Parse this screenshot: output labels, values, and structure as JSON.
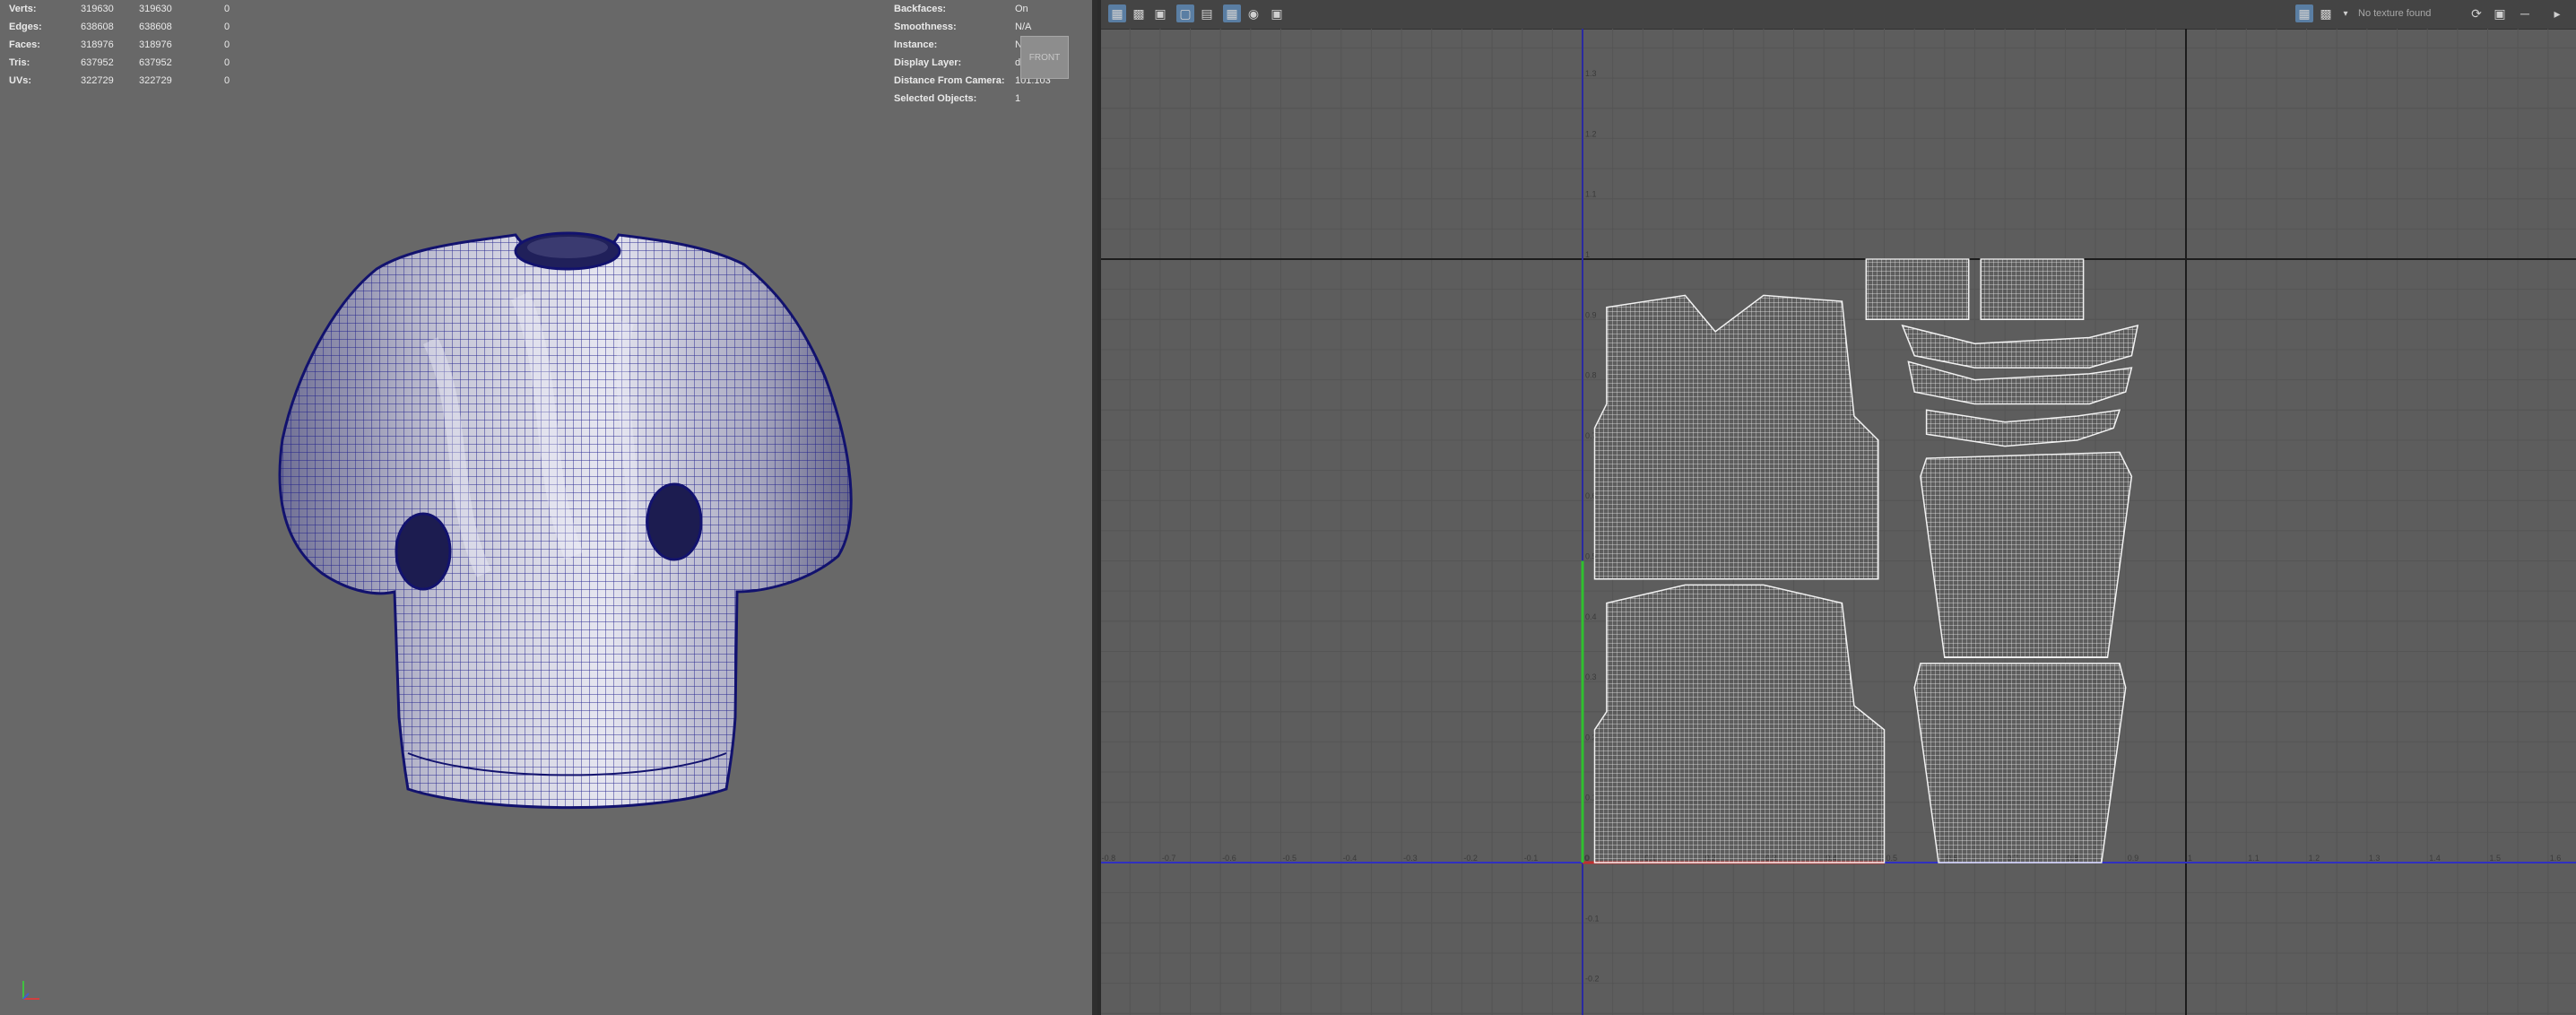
{
  "viewport": {
    "stats": [
      {
        "label": "Verts:",
        "v1": "319630",
        "v2": "319630",
        "v3": "0"
      },
      {
        "label": "Edges:",
        "v1": "638608",
        "v2": "638608",
        "v3": "0"
      },
      {
        "label": "Faces:",
        "v1": "318976",
        "v2": "318976",
        "v3": "0"
      },
      {
        "label": "Tris:",
        "v1": "637952",
        "v2": "637952",
        "v3": "0"
      },
      {
        "label": "UVs:",
        "v1": "322729",
        "v2": "322729",
        "v3": "0"
      }
    ],
    "info": [
      {
        "label": "Backfaces:",
        "value": "On"
      },
      {
        "label": "Smoothness:",
        "value": "N/A"
      },
      {
        "label": "Instance:",
        "value": "No"
      },
      {
        "label": "Display Layer:",
        "value": "default"
      },
      {
        "label": "Distance From Camera:",
        "value": "101.103"
      },
      {
        "label": "Selected Objects:",
        "value": "1"
      }
    ],
    "viewcube_label": "FRONT",
    "colors": {
      "wire": "#1a1a8a",
      "background": "#686868"
    }
  },
  "uv_editor": {
    "toolbar_icons": [
      "uv-select-icon",
      "uv-shell-icon",
      "uv-lattice-icon",
      "isolate-icon",
      "grid-toggle-icon",
      "snap-grid-icon",
      "shaded-uv-icon",
      "image-icon"
    ],
    "right_icons": [
      "texture-display-icon",
      "checker-icon",
      "dropdown-icon"
    ],
    "no_texture_label": "No texture found",
    "u_ticks": [
      "-0.8",
      "-0.7",
      "-0.6",
      "-0.5",
      "-0.4",
      "-0.3",
      "-0.2",
      "-0.1",
      "0",
      "0.1",
      "0.2",
      "0.3",
      "0.4",
      "0.5",
      "0.6",
      "0.7",
      "0.8",
      "0.9",
      "1",
      "1.1",
      "1.2",
      "1.3",
      "1.4",
      "1.5",
      "1.6"
    ],
    "v_ticks": [
      "-0.2",
      "-0.1",
      "0",
      "0.1",
      "0.2",
      "0.3",
      "0.4",
      "0.5",
      "0.6",
      "0.7",
      "0.8",
      "0.9",
      "1",
      "1.1",
      "1.2",
      "1.3"
    ],
    "colors": {
      "grid_minor": "#555555",
      "grid_major": "#1c1c1c",
      "u_axis": "#3030c0",
      "v_axis": "#2a2aa0",
      "uv_lines": "#f2f2f2",
      "highlight_u": "#c03030",
      "highlight_v": "#30c030"
    }
  }
}
